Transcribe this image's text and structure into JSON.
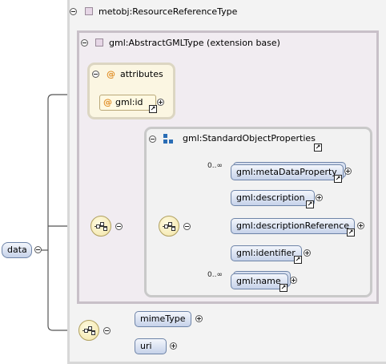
{
  "root": {
    "name": "data"
  },
  "complex_type": {
    "name": "metobj:ResourceReferenceType"
  },
  "extension_base": {
    "name": "gml:AbstractGMLType (extension base)"
  },
  "attributes_group": {
    "title": "attributes",
    "items": [
      {
        "name": "gml:id"
      }
    ]
  },
  "property_group": {
    "name": "gml:StandardObjectProperties",
    "elements": [
      {
        "name": "gml:metaDataProperty",
        "occurrence": "0..∞"
      },
      {
        "name": "gml:description",
        "occurrence": ""
      },
      {
        "name": "gml:descriptionReference",
        "occurrence": ""
      },
      {
        "name": "gml:identifier",
        "occurrence": ""
      },
      {
        "name": "gml:name",
        "occurrence": "0..∞"
      }
    ]
  },
  "local_sequence": {
    "elements": [
      {
        "name": "mimeType"
      },
      {
        "name": "uri"
      }
    ]
  },
  "symbols": {
    "attribute_marker": "@",
    "reference_arrow": "↗"
  },
  "colors": {
    "element_border": "#6e84a8",
    "element_fill": "#c6d2ea",
    "attribute_fill": "#fbf6e2",
    "base_fill": "#f1ecf1",
    "group_fill": "#f2f2f2",
    "group_icon": "#2a6db5"
  }
}
